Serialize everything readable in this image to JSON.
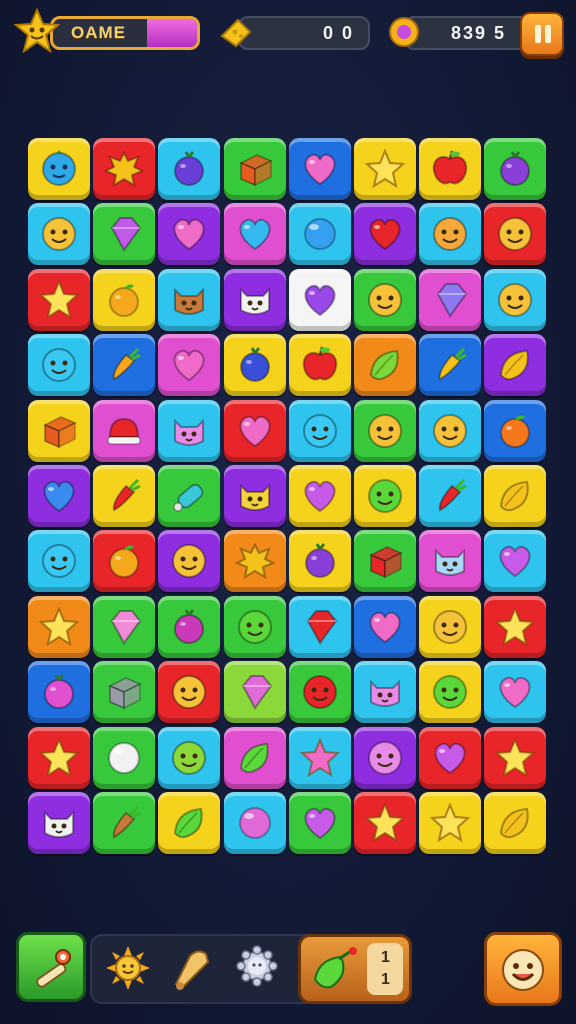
{
  "header": {
    "title": "OAME",
    "score_a": "0 0",
    "score_b": "839 5",
    "title_progress": 0.35,
    "icons": [
      "star-face-icon",
      "cheese-icon",
      "gem-icon",
      "pause-icon"
    ]
  },
  "colors": {
    "background": "#121a33",
    "yellow": "#f5d21c",
    "red": "#e8262a",
    "cyan": "#2fc4ee",
    "green": "#38c83c",
    "blue": "#1f6fe0",
    "purple": "#8e2ee0",
    "magenta": "#e04fd0",
    "orange": "#f28a1a",
    "lime": "#8ad83a",
    "white": "#f5f5f5"
  },
  "board": {
    "rows": [
      [
        [
          "yellow",
          "face-blue",
          "#2fa8e8"
        ],
        [
          "red",
          "splat",
          "#f5c21c"
        ],
        [
          "cyan",
          "berry",
          "#6a3fd8"
        ],
        [
          "green",
          "cube",
          "#e85a20"
        ],
        [
          "blue",
          "heart",
          "#f06ac8"
        ],
        [
          "yellow",
          "star",
          "#fde35a"
        ],
        [
          "yellow",
          "apple",
          "#e8262a"
        ],
        [
          "green",
          "berry",
          "#8a3fd8"
        ]
      ],
      [
        [
          "cyan",
          "face",
          "#f5c23a"
        ],
        [
          "green",
          "gem",
          "#c05ae8"
        ],
        [
          "purple",
          "heart",
          "#f06ac8"
        ],
        [
          "magenta",
          "heart",
          "#35b8f0"
        ],
        [
          "cyan",
          "ball",
          "#35a0f0"
        ],
        [
          "purple",
          "heart",
          "#e8262a"
        ],
        [
          "cyan",
          "face",
          "#f5a83a"
        ],
        [
          "red",
          "face",
          "#f5c23a"
        ]
      ],
      [
        [
          "red",
          "star",
          "#fde35a"
        ],
        [
          "yellow",
          "fruit",
          "#f5a81c"
        ],
        [
          "cyan",
          "cat",
          "#c8783a"
        ],
        [
          "purple",
          "cat",
          "#f2f2f2"
        ],
        [
          "white",
          "heart",
          "#9a48e8"
        ],
        [
          "green",
          "face",
          "#f5c23a"
        ],
        [
          "magenta",
          "gem",
          "#8e7af0"
        ],
        [
          "cyan",
          "face",
          "#f5c23a"
        ]
      ],
      [
        [
          "cyan",
          "face",
          "#3ac8f5"
        ],
        [
          "blue",
          "carrot",
          "#f5a81c"
        ],
        [
          "magenta",
          "heart",
          "#f06ac8"
        ],
        [
          "yellow",
          "berry",
          "#3a4fd8"
        ],
        [
          "yellow",
          "apple",
          "#e8262a"
        ],
        [
          "orange",
          "leaf",
          "#7ad83a"
        ],
        [
          "blue",
          "carrot",
          "#f5c21c"
        ],
        [
          "purple",
          "leaf",
          "#f5c21c"
        ]
      ],
      [
        [
          "yellow",
          "cube",
          "#e85a20"
        ],
        [
          "magenta",
          "hat",
          "#e8262a"
        ],
        [
          "cyan",
          "cat",
          "#e88ae8"
        ],
        [
          "red",
          "heart",
          "#f06ac8"
        ],
        [
          "cyan",
          "face",
          "#3ac8f5"
        ],
        [
          "green",
          "face",
          "#f5c23a"
        ],
        [
          "cyan",
          "face",
          "#f5c23a"
        ],
        [
          "blue",
          "fruit",
          "#f5781c"
        ]
      ],
      [
        [
          "purple",
          "heart",
          "#3a8af0"
        ],
        [
          "yellow",
          "carrot",
          "#e8262a"
        ],
        [
          "green",
          "bottle",
          "#3ac8d8"
        ],
        [
          "purple",
          "cat",
          "#f5d23a"
        ],
        [
          "yellow",
          "heart",
          "#c85ae8"
        ],
        [
          "yellow",
          "face",
          "#5ad83a"
        ],
        [
          "cyan",
          "carrot",
          "#e8262a"
        ],
        [
          "yellow",
          "leaf",
          "#f5c21c"
        ]
      ],
      [
        [
          "cyan",
          "face",
          "#3ac8f5"
        ],
        [
          "red",
          "fruit",
          "#f5a81c"
        ],
        [
          "purple",
          "face",
          "#f5c23a"
        ],
        [
          "orange",
          "splat",
          "#f5c21c"
        ],
        [
          "yellow",
          "berry",
          "#8a3fd8"
        ],
        [
          "green",
          "cube",
          "#e8262a"
        ],
        [
          "magenta",
          "cat",
          "#a8d8f5"
        ],
        [
          "cyan",
          "heart",
          "#c85ae8"
        ]
      ],
      [
        [
          "orange",
          "star",
          "#fde35a"
        ],
        [
          "green",
          "gem",
          "#f08ad8"
        ],
        [
          "green",
          "berry",
          "#c83ab8"
        ],
        [
          "green",
          "face",
          "#5ad83a"
        ],
        [
          "cyan",
          "gem",
          "#e8262a"
        ],
        [
          "blue",
          "heart",
          "#f06ac8"
        ],
        [
          "yellow",
          "face",
          "#f5c23a"
        ],
        [
          "red",
          "star",
          "#fde35a"
        ]
      ],
      [
        [
          "blue",
          "berry",
          "#e04fd0"
        ],
        [
          "green",
          "cube",
          "#9a9aa8"
        ],
        [
          "red",
          "face",
          "#f5c23a"
        ],
        [
          "lime",
          "gem",
          "#e06ad8"
        ],
        [
          "green",
          "face",
          "#e8262a"
        ],
        [
          "cyan",
          "cat",
          "#e88ae8"
        ],
        [
          "yellow",
          "face",
          "#5ad83a"
        ],
        [
          "cyan",
          "heart",
          "#f06ac8"
        ]
      ],
      [
        [
          "red",
          "star",
          "#fde35a"
        ],
        [
          "green",
          "ball",
          "#f2f2f2"
        ],
        [
          "cyan",
          "face",
          "#8ad83a"
        ],
        [
          "magenta",
          "leaf",
          "#5ad83a"
        ],
        [
          "cyan",
          "star",
          "#f06ac8"
        ],
        [
          "purple",
          "face",
          "#e88ae8"
        ],
        [
          "red",
          "heart",
          "#c85ae8"
        ],
        [
          "red",
          "star",
          "#fde35a"
        ]
      ],
      [
        [
          "purple",
          "cat",
          "#f2f2f2"
        ],
        [
          "green",
          "carrot",
          "#c8783a"
        ],
        [
          "yellow",
          "leaf",
          "#5ad83a"
        ],
        [
          "cyan",
          "ball",
          "#e06ad8"
        ],
        [
          "green",
          "heart",
          "#c85ae8"
        ],
        [
          "red",
          "star",
          "#fde35a"
        ],
        [
          "yellow",
          "star",
          "#fde35a"
        ],
        [
          "yellow",
          "leaf",
          "#f5c21c"
        ]
      ]
    ]
  },
  "bottom": {
    "left_button_icon": "magic-wand-icon",
    "tray_icons": [
      "sun-icon",
      "bell-icon",
      "gear-icon"
    ],
    "booster_icon": "leaf-booster-icon",
    "booster_count_top": "1",
    "booster_count_bottom": "1",
    "right_button_icon": "smile-face-icon"
  }
}
